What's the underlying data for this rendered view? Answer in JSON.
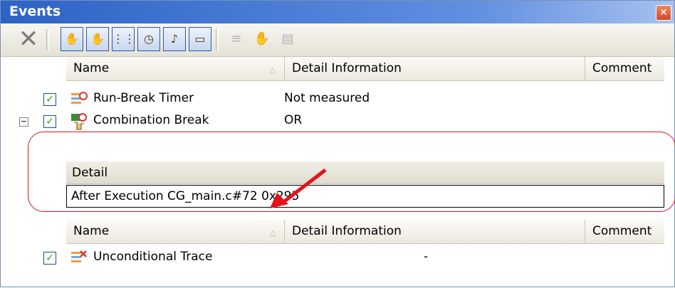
{
  "window": {
    "title": "Events",
    "close_glyph": "✕"
  },
  "toolbar": {
    "delete_icon": "x-delete-icon",
    "buttons": [
      "hand-icon",
      "hand-icon",
      "footprints-icon",
      "stopwatch-icon",
      "bell-icon",
      "monitor-icon"
    ],
    "disabled_buttons": [
      "document-icon",
      "hand-icon",
      "document-icon"
    ]
  },
  "headers": {
    "name": "Name",
    "detail": "Detail Information",
    "comment": "Comment",
    "sort_glyph": "△"
  },
  "events": [
    {
      "name": "Run-Break Timer",
      "detail": "Not measured",
      "checked": true,
      "icon": "timer-icon"
    },
    {
      "name": "Combination Break",
      "detail": "OR",
      "checked": true,
      "icon": "combination-break-icon",
      "expanded": true
    }
  ],
  "detail_pane": {
    "header": "Detail",
    "value": "After Execution  CG_main.c#72 0x295"
  },
  "trace_events": [
    {
      "name": "Unconditional Trace",
      "detail": "-",
      "checked": true,
      "icon": "trace-icon"
    }
  ],
  "symbols": {
    "check": "✓",
    "expander": "−"
  },
  "colors": {
    "title_bar": "#2d63c6",
    "highlight": "#e3121b",
    "check": "#21a121"
  }
}
